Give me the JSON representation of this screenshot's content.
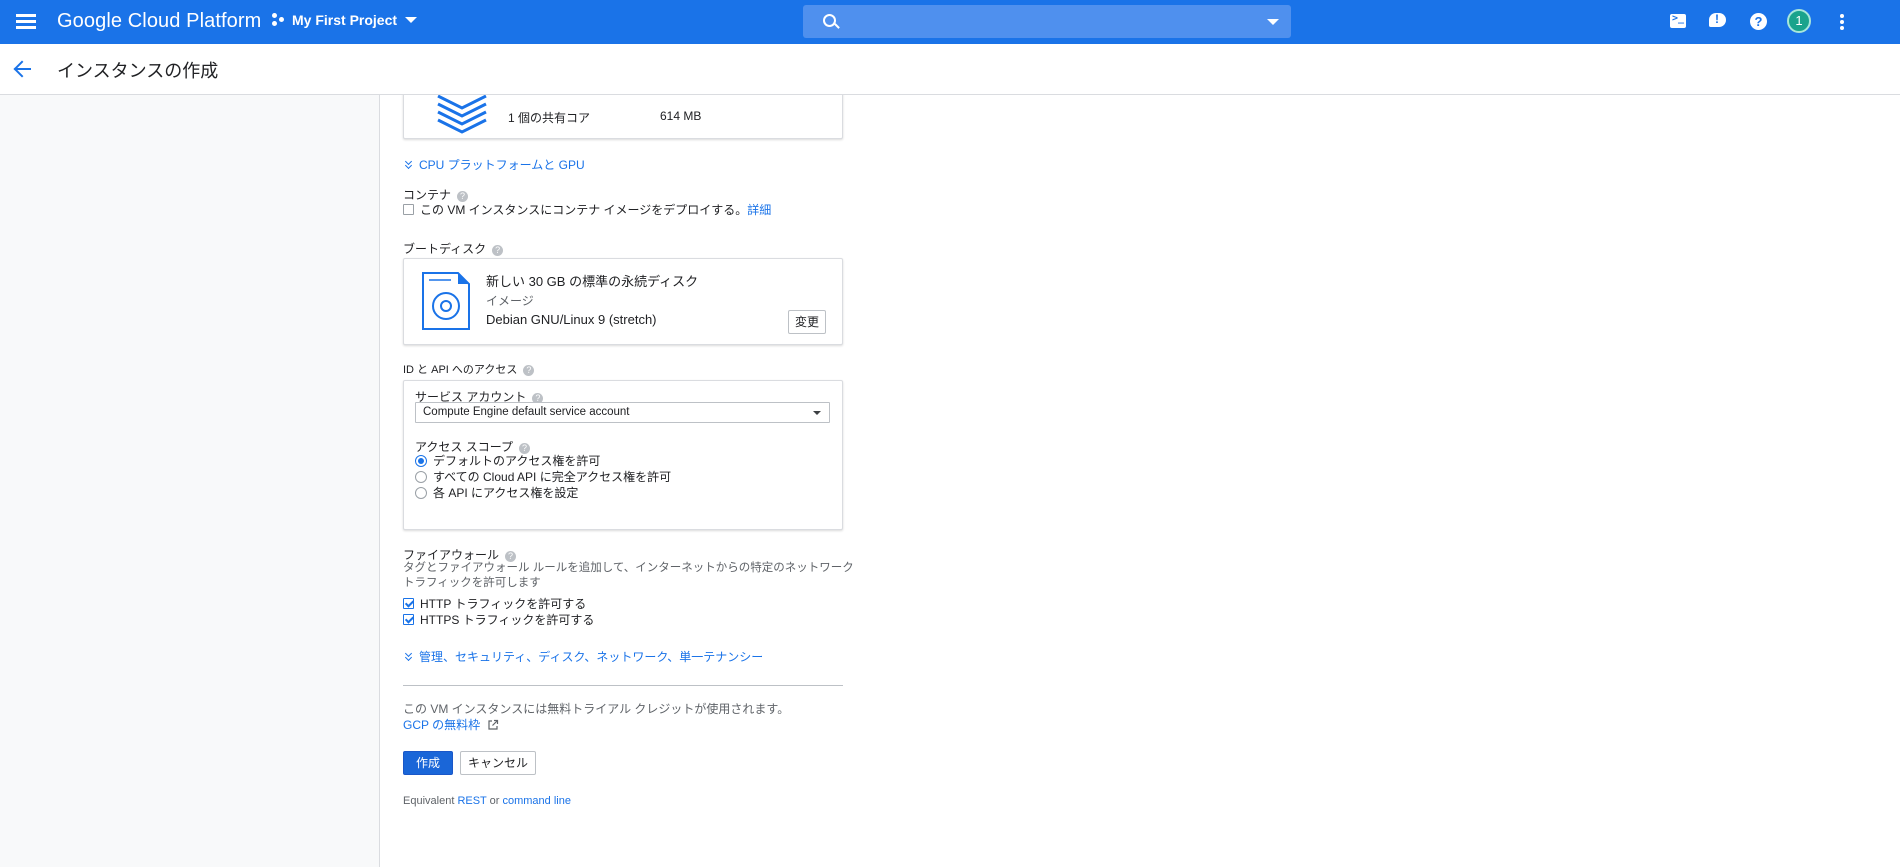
{
  "topbar": {
    "brand": "Google Cloud Platform",
    "project": "My First Project",
    "search_placeholder": "",
    "avatar_initial": "1",
    "brand_color": "#1a73e8"
  },
  "header": {
    "title": "インスタンスの作成"
  },
  "machine": {
    "cores": "1 個の共有コア",
    "memory": "614 MB"
  },
  "cpu_platform_link": "CPU プラットフォームと GPU",
  "container": {
    "label": "コンテナ",
    "checkbox_label": "この VM インスタンスにコンテナ イメージをデプロイする。",
    "details_link": "詳細"
  },
  "boot_disk": {
    "label": "ブートディスク",
    "title": "新しい 30 GB の標準の永続ディスク",
    "image_label": "イメージ",
    "image_name": "Debian GNU/Linux 9 (stretch)",
    "change_button": "変更"
  },
  "identity": {
    "label": "ID と API へのアクセス",
    "service_account_label": "サービス アカウント",
    "service_account_value": "Compute Engine default service account",
    "access_scope_label": "アクセス スコープ",
    "scopes": [
      {
        "label": "デフォルトのアクセス権を許可",
        "selected": true
      },
      {
        "label": "すべての Cloud API に完全アクセス権を許可",
        "selected": false
      },
      {
        "label": "各 API にアクセス権を設定",
        "selected": false
      }
    ]
  },
  "firewall": {
    "label": "ファイアウォール",
    "description_line1": "タグとファイアウォール ルールを追加して、インターネットからの特定のネットワーク",
    "description_line2": "トラフィックを許可します",
    "http_label": "HTTP トラフィックを許可する",
    "http_checked": true,
    "https_label": "HTTPS トラフィックを許可する",
    "https_checked": true
  },
  "management_link": "管理、セキュリティ、ディスク、ネットワーク、単一テナンシー",
  "trial": {
    "notice": "この VM インスタンスには無料トライアル クレジットが使用されます。",
    "free_tier_link": "GCP の無料枠"
  },
  "actions": {
    "create": "作成",
    "cancel": "キャンセル"
  },
  "equivalent": {
    "prefix": "Equivalent",
    "rest": "REST",
    "or": "or",
    "command_line": "command line"
  }
}
